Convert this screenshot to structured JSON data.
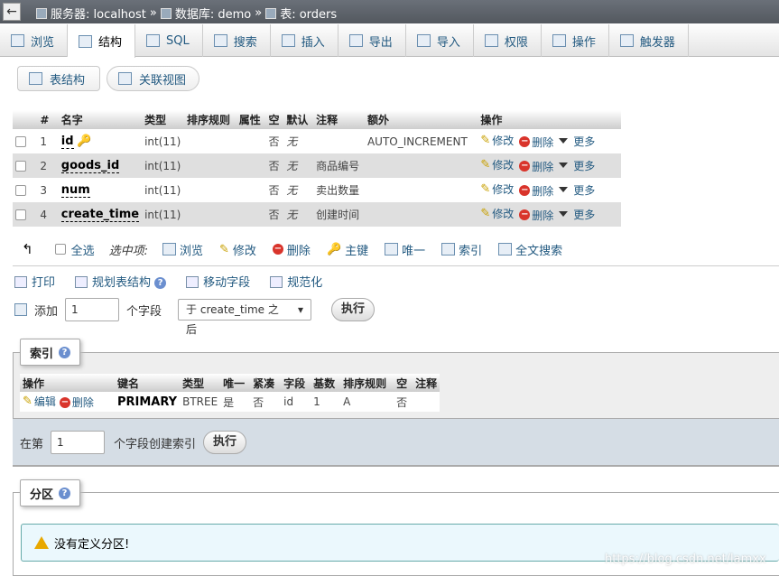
{
  "breadcrumb": {
    "server": "服务器: localhost",
    "database": "数据库: demo",
    "table": "表: orders",
    "sep": "»"
  },
  "tabs": [
    "浏览",
    "结构",
    "SQL",
    "搜索",
    "插入",
    "导出",
    "导入",
    "权限",
    "操作",
    "触发器"
  ],
  "subtabs": {
    "structure": "表结构",
    "relation": "关联视图"
  },
  "columns_header": [
    "#",
    "名字",
    "类型",
    "排序规则",
    "属性",
    "空",
    "默认",
    "注释",
    "额外",
    "操作"
  ],
  "rows": [
    {
      "num": "1",
      "name": "id",
      "type": "int(11)",
      "null": "否",
      "default": "无",
      "comment": "",
      "extra": "AUTO_INCREMENT"
    },
    {
      "num": "2",
      "name": "goods_id",
      "type": "int(11)",
      "null": "否",
      "default": "无",
      "comment": "商品编号",
      "extra": ""
    },
    {
      "num": "3",
      "name": "num",
      "type": "int(11)",
      "null": "否",
      "default": "无",
      "comment": "卖出数量",
      "extra": ""
    },
    {
      "num": "4",
      "name": "create_time",
      "type": "int(11)",
      "null": "否",
      "default": "无",
      "comment": "创建时间",
      "extra": ""
    }
  ],
  "row_actions": {
    "edit": "修改",
    "drop": "删除",
    "more": "更多"
  },
  "selection": {
    "check_all": "全选",
    "selected": "选中项:",
    "browse": "浏览",
    "edit": "修改",
    "drop": "删除",
    "primary": "主键",
    "unique": "唯一",
    "index": "索引",
    "fulltext": "全文搜索"
  },
  "ops": {
    "print": "打印",
    "propose": "规划表结构",
    "move": "移动字段",
    "normalize": "规范化"
  },
  "add": {
    "label": "添加",
    "count": "1",
    "fields": "个字段",
    "position": "于 create_time 之后",
    "go": "执行"
  },
  "indexes": {
    "title": "索引",
    "header": [
      "操作",
      "键名",
      "类型",
      "唯一",
      "紧凑",
      "字段",
      "基数",
      "排序规则",
      "空",
      "注释"
    ],
    "row": {
      "edit": "编辑",
      "drop": "删除",
      "key": "PRIMARY",
      "type": "BTREE",
      "unique": "是",
      "packed": "否",
      "column": "id",
      "cardinality": "1",
      "collation": "A",
      "null": "否",
      "comment": ""
    },
    "create_prefix": "在第",
    "create_count": "1",
    "create_suffix": "个字段创建索引",
    "go": "执行"
  },
  "partitions": {
    "title": "分区",
    "notice": "没有定义分区!"
  },
  "watermark": "https://blog.csdn.net/lamxx"
}
